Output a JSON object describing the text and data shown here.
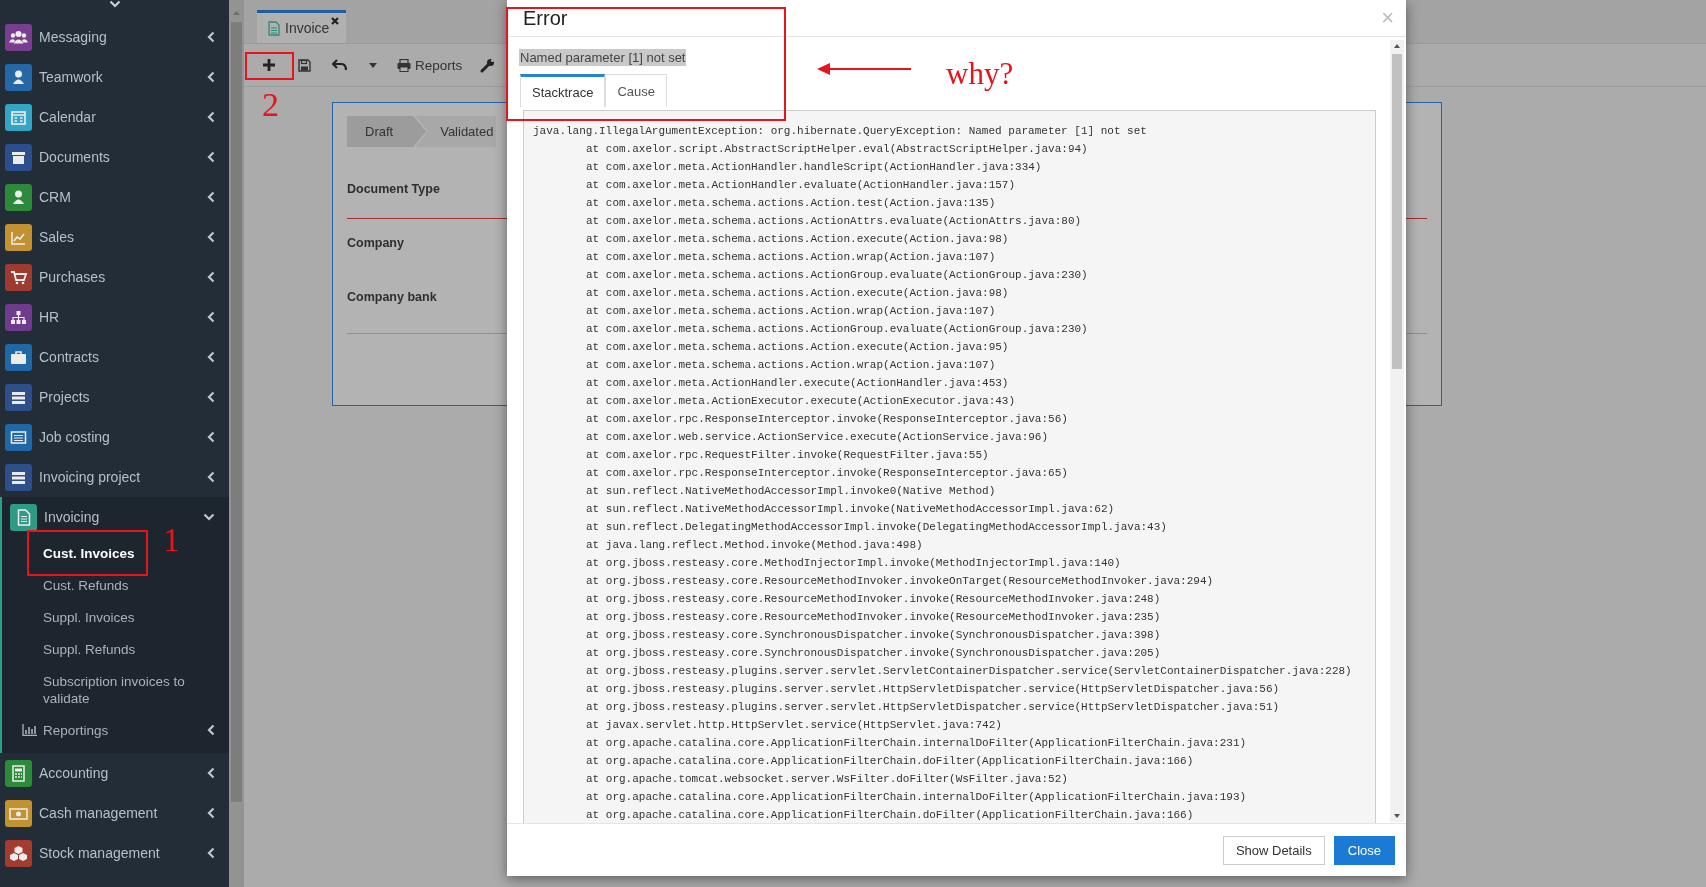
{
  "sidebar": {
    "items": [
      {
        "label": "Messaging",
        "color": "#7a3e91",
        "expanded": false
      },
      {
        "label": "Teamwork",
        "color": "#2468a8",
        "expanded": false
      },
      {
        "label": "Calendar",
        "color": "#33a6c6",
        "expanded": false
      },
      {
        "label": "Documents",
        "color": "#2b4e8e",
        "expanded": false
      },
      {
        "label": "CRM",
        "color": "#2e8a3b",
        "expanded": false
      },
      {
        "label": "Sales",
        "color": "#c1922f",
        "expanded": false
      },
      {
        "label": "Purchases",
        "color": "#9e3a30",
        "expanded": false
      },
      {
        "label": "HR",
        "color": "#6f3b8f",
        "expanded": false
      },
      {
        "label": "Contracts",
        "color": "#2067a7",
        "expanded": false
      },
      {
        "label": "Projects",
        "color": "#2d4f8c",
        "expanded": false
      },
      {
        "label": "Job costing",
        "color": "#2166a6",
        "expanded": false
      },
      {
        "label": "Invoicing project",
        "color": "#2d4f8c",
        "expanded": false
      },
      {
        "label": "Invoicing",
        "color": "#2f9a86",
        "expanded": true,
        "children": [
          {
            "label": "Cust. Invoices",
            "kind": "link",
            "selected": true
          },
          {
            "label": "Cust. Refunds",
            "kind": "link",
            "selected": false
          },
          {
            "label": "Suppl. Invoices",
            "kind": "link",
            "selected": false
          },
          {
            "label": "Suppl. Refunds",
            "kind": "link",
            "selected": false
          },
          {
            "label": "Subscription invoices to validate",
            "kind": "link",
            "selected": false
          },
          {
            "label": "Reportings",
            "kind": "submenu",
            "selected": false,
            "expanded": false
          }
        ]
      },
      {
        "label": "Accounting",
        "color": "#2c8a3b",
        "expanded": false
      },
      {
        "label": "Cash management",
        "color": "#c1922f",
        "expanded": false
      },
      {
        "label": "Stock management",
        "color": "#a33b31",
        "expanded": false
      }
    ]
  },
  "tabs": [
    {
      "label": "Invoice",
      "selected": true
    }
  ],
  "toolbar": {
    "reports": "Reports"
  },
  "form": {
    "statuses": [
      {
        "label": "Draft",
        "selected": true
      },
      {
        "label": "Validated",
        "selected": false
      }
    ],
    "fields": [
      {
        "label": "Document Type",
        "invalid": true
      },
      {
        "label": "Company",
        "invalid": false
      },
      {
        "label": "Company bank",
        "invalid": false
      }
    ]
  },
  "dialog": {
    "title": "Error",
    "close": "×",
    "message": "Named parameter [1] not set",
    "tabs": [
      {
        "label": "Stacktrace",
        "selected": true
      },
      {
        "label": "Cause",
        "selected": false
      }
    ],
    "stacktrace": {
      "exception": "java.lang.IllegalArgumentException: org.hibernate.QueryException: Named parameter [1] not set",
      "frames": [
        "at com.axelor.script.AbstractScriptHelper.eval(AbstractScriptHelper.java:94)",
        "at com.axelor.meta.ActionHandler.handleScript(ActionHandler.java:334)",
        "at com.axelor.meta.ActionHandler.evaluate(ActionHandler.java:157)",
        "at com.axelor.meta.schema.actions.Action.test(Action.java:135)",
        "at com.axelor.meta.schema.actions.ActionAttrs.evaluate(ActionAttrs.java:80)",
        "at com.axelor.meta.schema.actions.Action.execute(Action.java:98)",
        "at com.axelor.meta.schema.actions.Action.wrap(Action.java:107)",
        "at com.axelor.meta.schema.actions.ActionGroup.evaluate(ActionGroup.java:230)",
        "at com.axelor.meta.schema.actions.Action.execute(Action.java:98)",
        "at com.axelor.meta.schema.actions.Action.wrap(Action.java:107)",
        "at com.axelor.meta.schema.actions.ActionGroup.evaluate(ActionGroup.java:230)",
        "at com.axelor.meta.schema.actions.Action.execute(Action.java:95)",
        "at com.axelor.meta.schema.actions.Action.wrap(Action.java:107)",
        "at com.axelor.meta.ActionHandler.execute(ActionHandler.java:453)",
        "at com.axelor.meta.ActionExecutor.execute(ActionExecutor.java:43)",
        "at com.axelor.rpc.ResponseInterceptor.invoke(ResponseInterceptor.java:56)",
        "at com.axelor.web.service.ActionService.execute(ActionService.java:96)",
        "at com.axelor.rpc.RequestFilter.invoke(RequestFilter.java:55)",
        "at com.axelor.rpc.ResponseInterceptor.invoke(ResponseInterceptor.java:65)",
        "at sun.reflect.NativeMethodAccessorImpl.invoke0(Native Method)",
        "at sun.reflect.NativeMethodAccessorImpl.invoke(NativeMethodAccessorImpl.java:62)",
        "at sun.reflect.DelegatingMethodAccessorImpl.invoke(DelegatingMethodAccessorImpl.java:43)",
        "at java.lang.reflect.Method.invoke(Method.java:498)",
        "at org.jboss.resteasy.core.MethodInjectorImpl.invoke(MethodInjectorImpl.java:140)",
        "at org.jboss.resteasy.core.ResourceMethodInvoker.invokeOnTarget(ResourceMethodInvoker.java:294)",
        "at org.jboss.resteasy.core.ResourceMethodInvoker.invoke(ResourceMethodInvoker.java:248)",
        "at org.jboss.resteasy.core.ResourceMethodInvoker.invoke(ResourceMethodInvoker.java:235)",
        "at org.jboss.resteasy.core.SynchronousDispatcher.invoke(SynchronousDispatcher.java:398)",
        "at org.jboss.resteasy.core.SynchronousDispatcher.invoke(SynchronousDispatcher.java:205)",
        "at org.jboss.resteasy.plugins.server.servlet.ServletContainerDispatcher.service(ServletContainerDispatcher.java:228)",
        "at org.jboss.resteasy.plugins.server.servlet.HttpServletDispatcher.service(HttpServletDispatcher.java:56)",
        "at org.jboss.resteasy.plugins.server.servlet.HttpServletDispatcher.service(HttpServletDispatcher.java:51)",
        "at javax.servlet.http.HttpServlet.service(HttpServlet.java:742)",
        "at org.apache.catalina.core.ApplicationFilterChain.internalDoFilter(ApplicationFilterChain.java:231)",
        "at org.apache.catalina.core.ApplicationFilterChain.doFilter(ApplicationFilterChain.java:166)",
        "at org.apache.tomcat.websocket.server.WsFilter.doFilter(WsFilter.java:52)",
        "at org.apache.catalina.core.ApplicationFilterChain.internalDoFilter(ApplicationFilterChain.java:193)",
        "at org.apache.catalina.core.ApplicationFilterChain.doFilter(ApplicationFilterChain.java:166)"
      ]
    },
    "buttons": [
      {
        "label": "Show Details",
        "kind": "default"
      },
      {
        "label": "Close",
        "kind": "primary"
      }
    ]
  },
  "annotations": [
    {
      "kind": "note",
      "text": "why?"
    },
    {
      "kind": "number",
      "text": "1"
    },
    {
      "kind": "number",
      "text": "2"
    }
  ]
}
